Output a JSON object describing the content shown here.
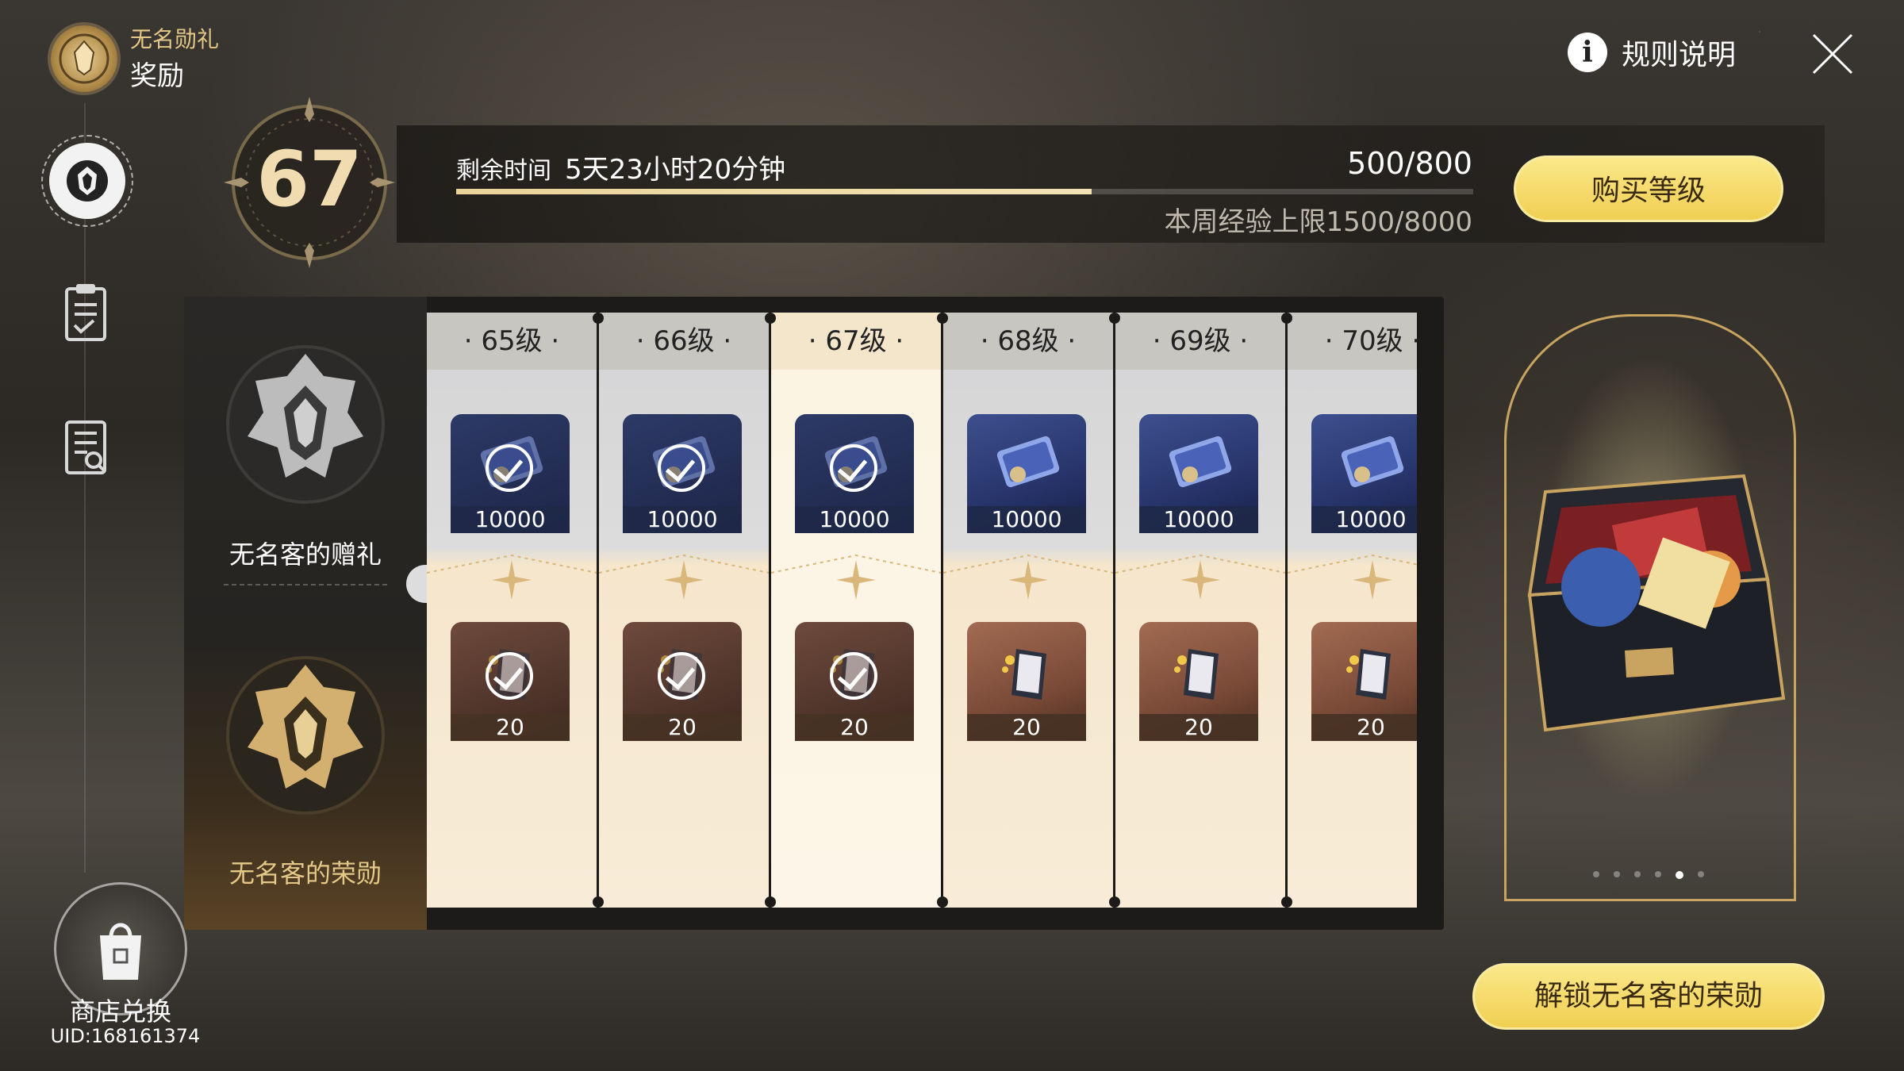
{
  "header": {
    "subtitle": "无名勋礼",
    "title": "奖励",
    "rules_label": "规则说明",
    "info_glyph": "i"
  },
  "nav": {
    "items": [
      {
        "name": "rewards",
        "icon": "emblem-icon",
        "active": true
      },
      {
        "name": "missions",
        "icon": "clipboard-check-icon",
        "active": false
      },
      {
        "name": "records",
        "icon": "document-search-icon",
        "active": false
      }
    ],
    "shop_label": "商店兑换",
    "uid": "UID:168161374"
  },
  "level": {
    "current": "67",
    "time_label": "剩余时间",
    "time_value": "5天23小时20分钟",
    "exp": "500/800",
    "exp_fraction": 0.625,
    "weekly_cap": "本周经验上限1500/8000",
    "buy_label": "购买等级"
  },
  "tiers": {
    "free_name": "无名客的赠礼",
    "paid_name": "无名客的荣勋"
  },
  "levels": [
    {
      "label": "65级",
      "free_qty": "10000",
      "paid_qty": "20",
      "claimed": true,
      "current": false
    },
    {
      "label": "66级",
      "free_qty": "10000",
      "paid_qty": "20",
      "claimed": true,
      "current": false
    },
    {
      "label": "67级",
      "free_qty": "10000",
      "paid_qty": "20",
      "claimed": true,
      "current": true
    },
    {
      "label": "68级",
      "free_qty": "10000",
      "paid_qty": "20",
      "claimed": false,
      "current": false
    },
    {
      "label": "69级",
      "free_qty": "10000",
      "paid_qty": "20",
      "claimed": false,
      "current": false
    },
    {
      "label": "70级",
      "free_qty": "10000",
      "paid_qty": "20",
      "claimed": false,
      "current": false
    }
  ],
  "preview": {
    "page_count": 6,
    "active_page": 5,
    "unlock_label": "解锁无名客的荣勋"
  },
  "colors": {
    "accent_gold": "#f0cf52",
    "gold_line": "#c9a460",
    "panel_dark": "#1c1b1a"
  }
}
